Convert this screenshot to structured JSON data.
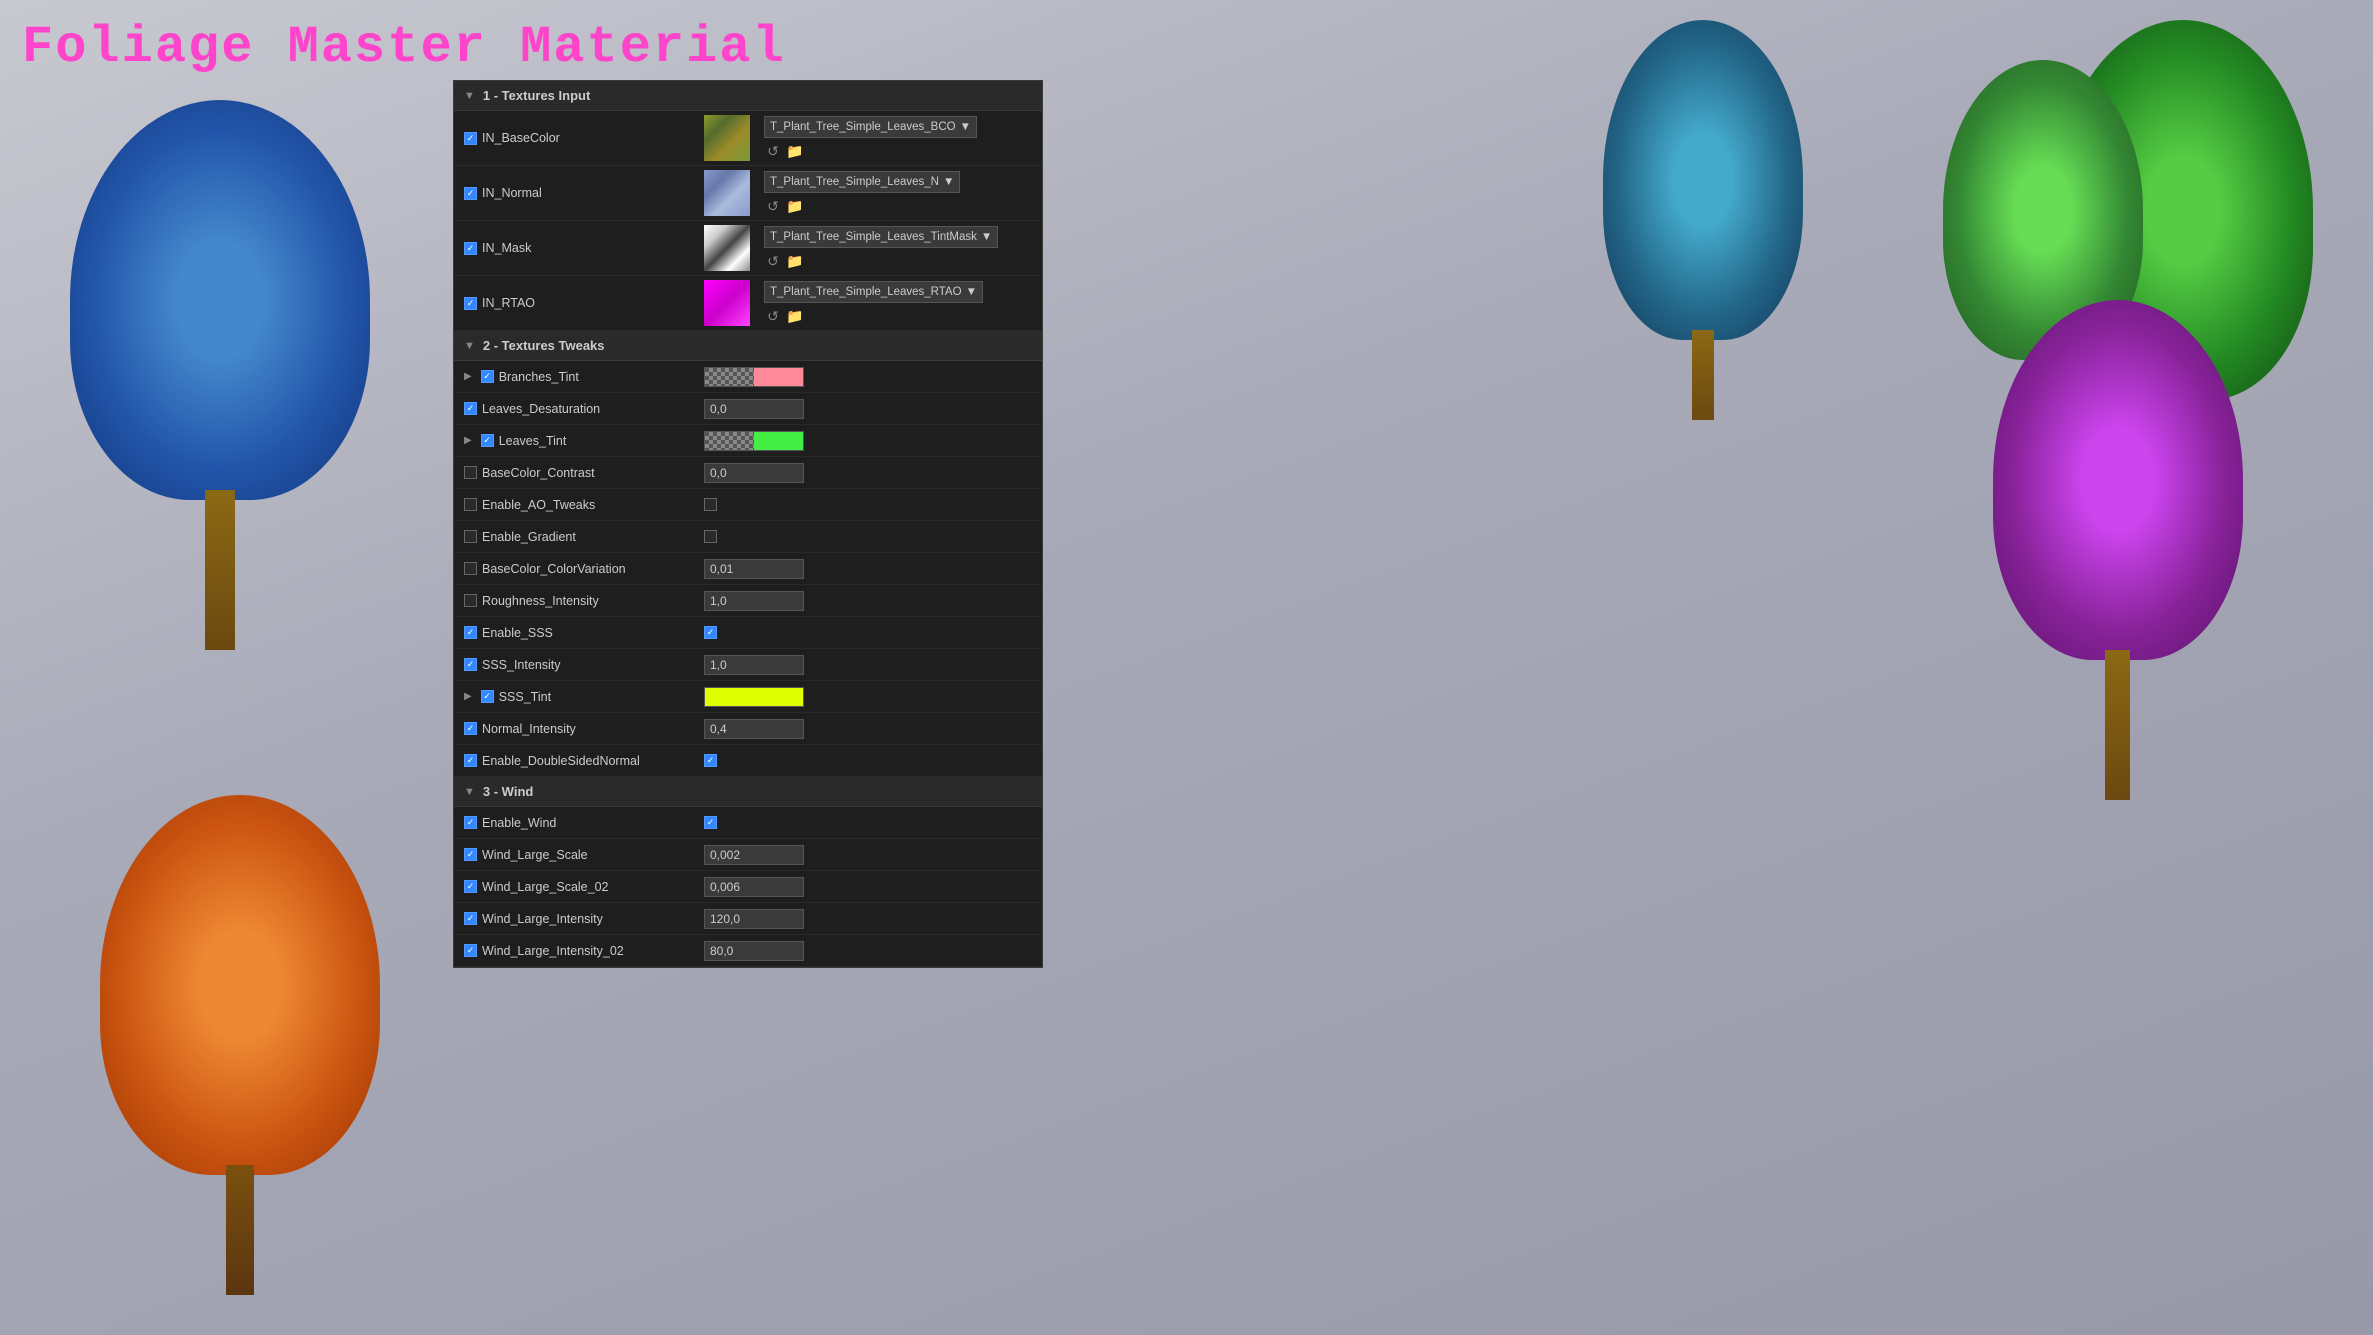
{
  "title": "Foliage Master Material",
  "panel": {
    "sections": [
      {
        "id": "textures-input",
        "label": "1 - Textures Input",
        "params": [
          {
            "name": "IN_BaseColor",
            "checked": true,
            "type": "texture",
            "value": "T_Plant_Tree_Simple_Leaves_BCO",
            "thumb_type": "yellow-green"
          },
          {
            "name": "IN_Normal",
            "checked": true,
            "type": "texture",
            "value": "T_Plant_Tree_Simple_Leaves_N",
            "thumb_type": "blue-purple"
          },
          {
            "name": "IN_Mask",
            "checked": true,
            "type": "texture",
            "value": "T_Plant_Tree_Simple_Leaves_TintMask",
            "thumb_type": "white-black"
          },
          {
            "name": "IN_RTAO",
            "checked": true,
            "type": "texture",
            "value": "T_Plant_Tree_Simple_Leaves_RTAO",
            "thumb_type": "magenta"
          }
        ]
      },
      {
        "id": "textures-tweaks",
        "label": "2 - Textures Tweaks",
        "params": [
          {
            "name": "Branches_Tint",
            "checked": true,
            "type": "color",
            "has_arrow": true,
            "color": "#ff8899",
            "checker": true
          },
          {
            "name": "Leaves_Desaturation",
            "checked": true,
            "type": "number",
            "value": "0,0"
          },
          {
            "name": "Leaves_Tint",
            "checked": true,
            "type": "color",
            "has_arrow": true,
            "color": "#44ee44",
            "checker": true
          },
          {
            "name": "BaseColor_Contrast",
            "checked": false,
            "type": "number",
            "value": "0,0"
          },
          {
            "name": "Enable_AO_Tweaks",
            "checked": false,
            "type": "checkbox_val",
            "value": false
          },
          {
            "name": "Enable_Gradient",
            "checked": false,
            "type": "checkbox_val",
            "value": false
          },
          {
            "name": "BaseColor_ColorVariation",
            "checked": false,
            "type": "number",
            "value": "0,01"
          },
          {
            "name": "Roughness_Intensity",
            "checked": false,
            "type": "number",
            "value": "1,0"
          },
          {
            "name": "Enable_SSS",
            "checked": true,
            "type": "checkbox_val",
            "value": true
          },
          {
            "name": "SSS_Intensity",
            "checked": true,
            "type": "number",
            "value": "1,0"
          },
          {
            "name": "SSS_Tint",
            "checked": true,
            "type": "color",
            "has_arrow": true,
            "color": "#ddff00",
            "checker": false
          },
          {
            "name": "Normal_Intensity",
            "checked": true,
            "type": "number",
            "value": "0,4"
          },
          {
            "name": "Enable_DoubleSidedNormal",
            "checked": true,
            "type": "checkbox_val",
            "value": true
          }
        ]
      },
      {
        "id": "wind",
        "label": "3 - Wind",
        "params": [
          {
            "name": "Enable_Wind",
            "checked": true,
            "type": "checkbox_val",
            "value": true
          },
          {
            "name": "Wind_Large_Scale",
            "checked": true,
            "type": "number",
            "value": "0,002"
          },
          {
            "name": "Wind_Large_Scale_02",
            "checked": true,
            "type": "number",
            "value": "0,006"
          },
          {
            "name": "Wind_Large_Intensity",
            "checked": true,
            "type": "number",
            "value": "120,0"
          },
          {
            "name": "Wind_Large_Intensity_02",
            "checked": true,
            "type": "number",
            "value": "80,0"
          }
        ]
      }
    ]
  },
  "icons": {
    "reset": "↺",
    "browse": "📁",
    "arrow_down": "▼",
    "arrow_right": "▶",
    "check": "✓"
  }
}
